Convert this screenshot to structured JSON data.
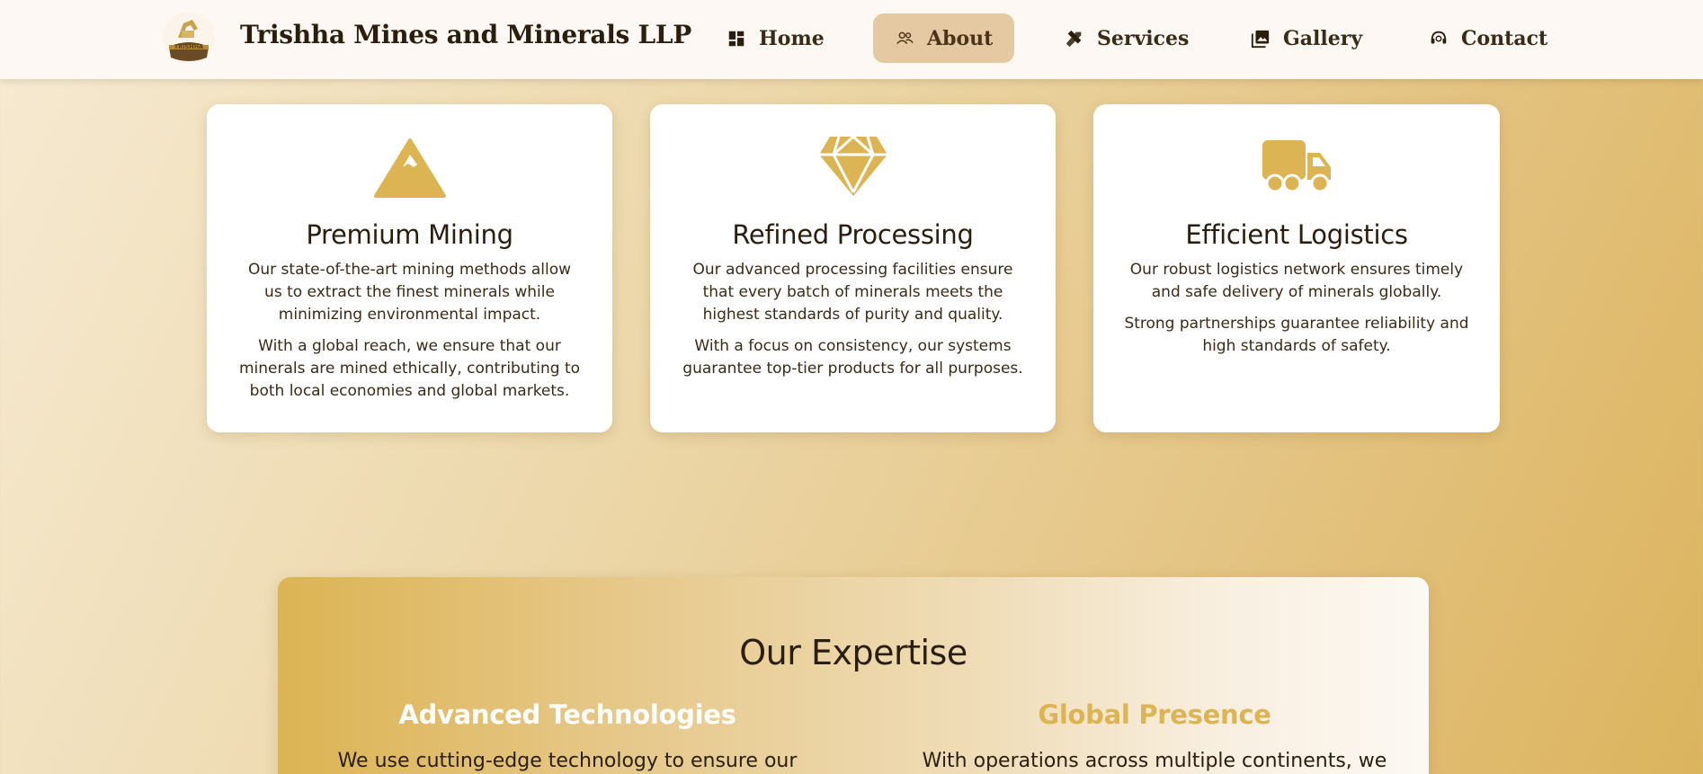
{
  "header": {
    "brand": "Trishha Mines and Minerals LLP",
    "logo_text": "TRISHHA",
    "nav": [
      {
        "label": "Home",
        "icon": "dashboard-icon",
        "active": false
      },
      {
        "label": "About",
        "icon": "people-icon",
        "active": true
      },
      {
        "label": "Services",
        "icon": "tools-icon",
        "active": false
      },
      {
        "label": "Gallery",
        "icon": "gallery-icon",
        "active": false
      },
      {
        "label": "Contact",
        "icon": "support-agent-icon",
        "active": false
      }
    ]
  },
  "cards": [
    {
      "icon": "mountain-icon",
      "title": "Premium Mining",
      "paragraphs": [
        "Our state-of-the-art mining methods allow us to extract the finest minerals while minimizing environmental impact.",
        "With a global reach, we ensure that our minerals are mined ethically, contributing to both local economies and global markets."
      ]
    },
    {
      "icon": "diamond-icon",
      "title": "Refined Processing",
      "paragraphs": [
        "Our advanced processing facilities ensure that every batch of minerals meets the highest standards of purity and quality.",
        "With a focus on consistency, our systems guarantee top-tier products for all purposes."
      ]
    },
    {
      "icon": "truck-icon",
      "title": "Efficient Logistics",
      "paragraphs": [
        "Our robust logistics network ensures timely and safe delivery of minerals globally.",
        "Strong partnerships guarantee reliability and high standards of safety."
      ]
    }
  ],
  "expertise": {
    "title": "Our Expertise",
    "columns": [
      {
        "heading": "Advanced Technologies",
        "text": "We use cutting-edge technology to ensure our methods",
        "heading_color": "#ffffff"
      },
      {
        "heading": "Global Presence",
        "text": "With operations across multiple continents, we serve",
        "heading_color": "#dcb453"
      }
    ]
  },
  "colors": {
    "accent": "#dcb453",
    "nav_active_bg": "#e5c9a2",
    "header_bg": "#fdf8f3",
    "text_dark": "#2b1e0f"
  }
}
